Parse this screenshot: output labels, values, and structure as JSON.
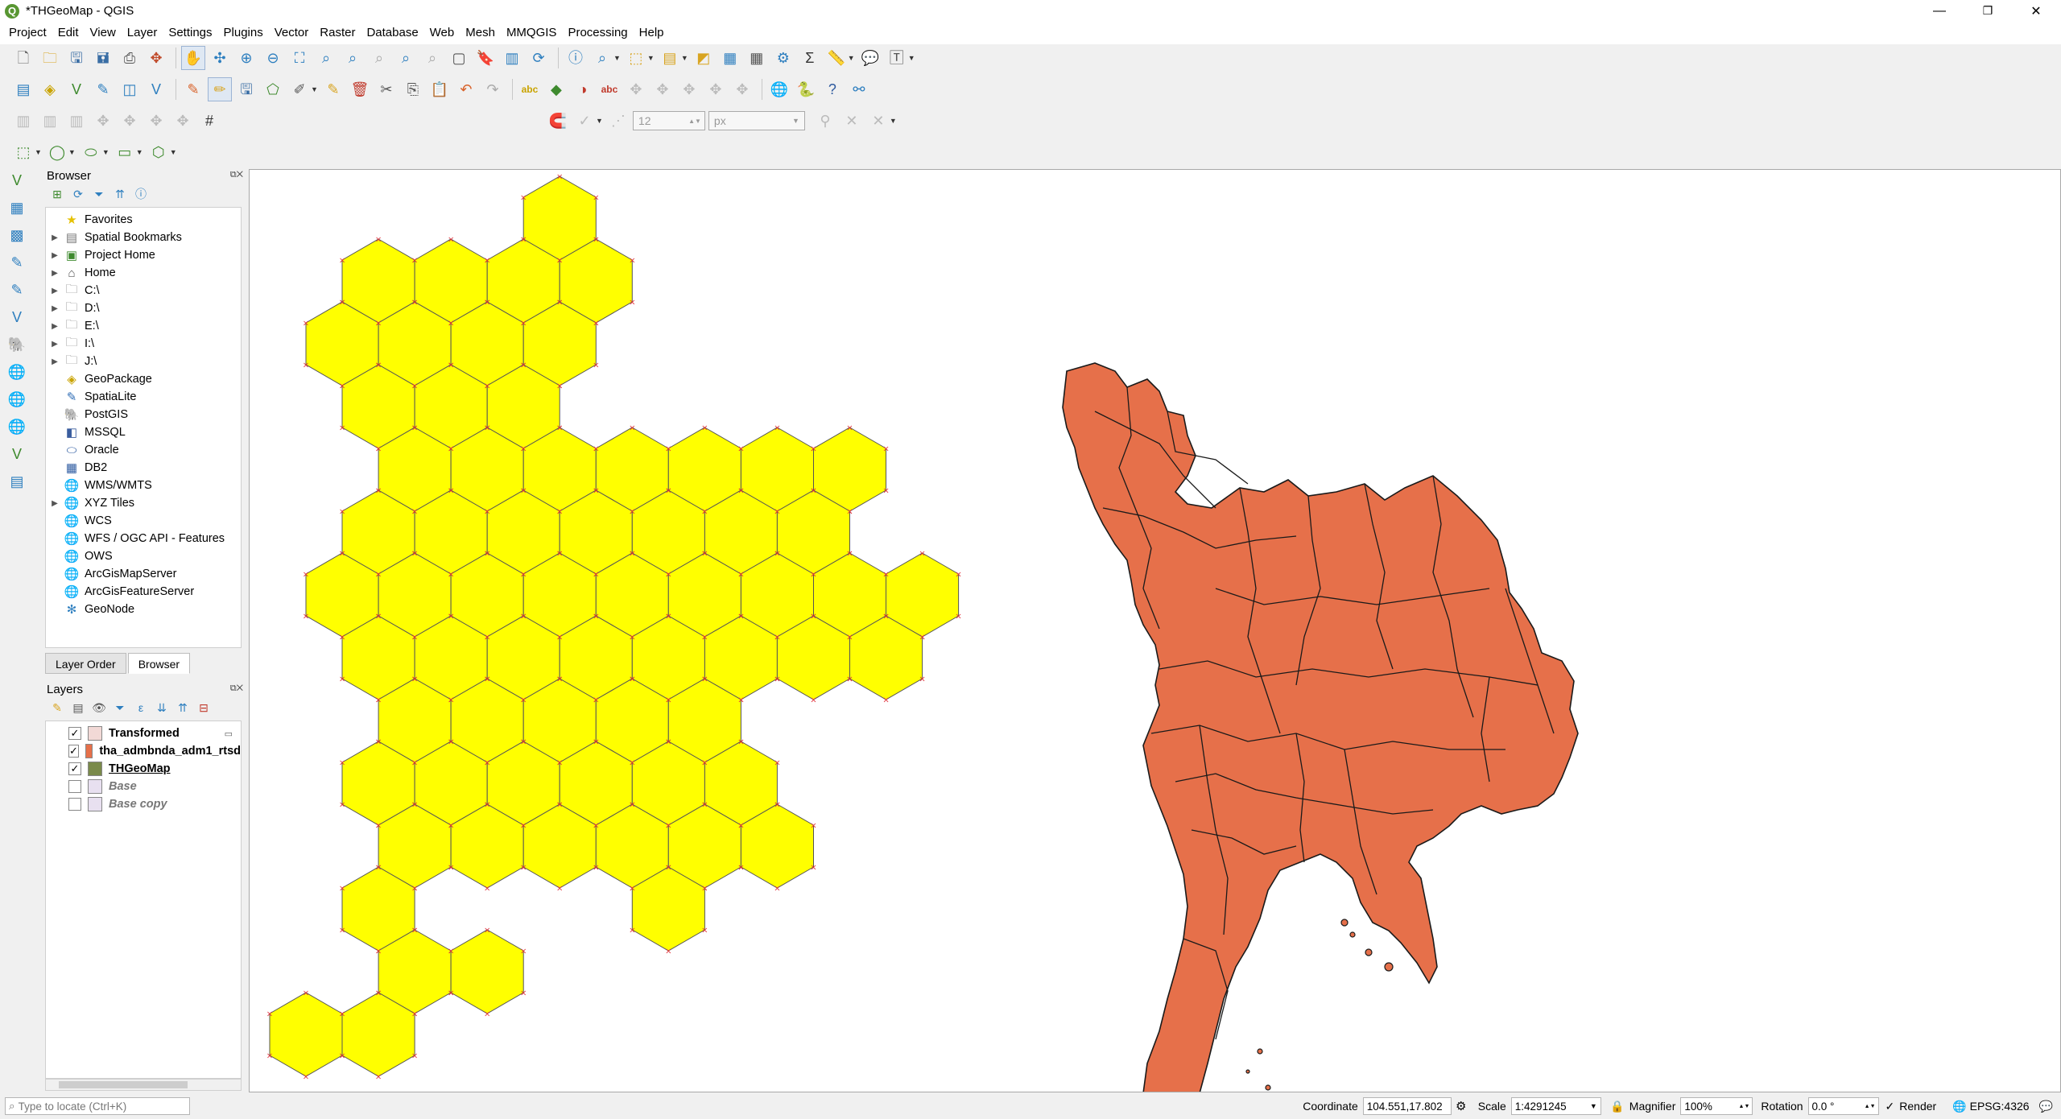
{
  "window": {
    "title": "*THGeoMap - QGIS",
    "app_icon_letter": "Q",
    "minimize": "—",
    "maximize": "❐",
    "close": "✕"
  },
  "menubar": [
    "Project",
    "Edit",
    "View",
    "Layer",
    "Settings",
    "Plugins",
    "Vector",
    "Raster",
    "Database",
    "Web",
    "Mesh",
    "MMQGIS",
    "Processing",
    "Help"
  ],
  "digitizing": {
    "size_value": "12",
    "unit": "px"
  },
  "browser": {
    "title": "Browser",
    "items": [
      {
        "label": "Favorites",
        "icon": "star-icon",
        "glyph": "★",
        "color": "#e5c100",
        "expandable": false
      },
      {
        "label": "Spatial Bookmarks",
        "icon": "bookmark-icon",
        "glyph": "▤",
        "color": "#777",
        "expandable": true
      },
      {
        "label": "Project Home",
        "icon": "project-home-icon",
        "glyph": "▣",
        "color": "#3e8a2e",
        "expandable": true
      },
      {
        "label": "Home",
        "icon": "home-icon",
        "glyph": "⌂",
        "color": "#555",
        "expandable": true
      },
      {
        "label": "C:\\",
        "icon": "folder-icon",
        "glyph": "🗀",
        "color": "#777",
        "expandable": true
      },
      {
        "label": "D:\\",
        "icon": "folder-icon",
        "glyph": "🗀",
        "color": "#777",
        "expandable": true
      },
      {
        "label": "E:\\",
        "icon": "folder-icon",
        "glyph": "🗀",
        "color": "#777",
        "expandable": true
      },
      {
        "label": "I:\\",
        "icon": "folder-icon",
        "glyph": "🗀",
        "color": "#777",
        "expandable": true
      },
      {
        "label": "J:\\",
        "icon": "folder-icon",
        "glyph": "🗀",
        "color": "#777",
        "expandable": true
      },
      {
        "label": "GeoPackage",
        "icon": "geopackage-icon",
        "glyph": "◈",
        "color": "#c9a300",
        "expandable": false
      },
      {
        "label": "SpatiaLite",
        "icon": "spatialite-icon",
        "glyph": "✎",
        "color": "#2f6db5",
        "expandable": false
      },
      {
        "label": "PostGIS",
        "icon": "postgis-icon",
        "glyph": "🐘",
        "color": "#336791",
        "expandable": false
      },
      {
        "label": "MSSQL",
        "icon": "mssql-icon",
        "glyph": "◧",
        "color": "#3a5d9e",
        "expandable": false
      },
      {
        "label": "Oracle",
        "icon": "oracle-icon",
        "glyph": "⬭",
        "color": "#2c5aa0",
        "expandable": false
      },
      {
        "label": "DB2",
        "icon": "db2-icon",
        "glyph": "▦",
        "color": "#2c5aa0",
        "expandable": false
      },
      {
        "label": "WMS/WMTS",
        "icon": "wms-globe-icon",
        "glyph": "🌐",
        "color": "#2e7fbf",
        "expandable": false
      },
      {
        "label": "XYZ Tiles",
        "icon": "xyz-tiles-icon",
        "glyph": "🌐",
        "color": "#2e7fbf",
        "expandable": true
      },
      {
        "label": "WCS",
        "icon": "wcs-globe-icon",
        "glyph": "🌐",
        "color": "#2e7fbf",
        "expandable": false
      },
      {
        "label": "WFS / OGC API - Features",
        "icon": "wfs-globe-icon",
        "glyph": "🌐",
        "color": "#2e7fbf",
        "expandable": false
      },
      {
        "label": "OWS",
        "icon": "ows-globe-icon",
        "glyph": "🌐",
        "color": "#8fa9c4",
        "expandable": false
      },
      {
        "label": "ArcGisMapServer",
        "icon": "arcgis-map-icon",
        "glyph": "🌐",
        "color": "#2e7fbf",
        "expandable": false
      },
      {
        "label": "ArcGisFeatureServer",
        "icon": "arcgis-feature-icon",
        "glyph": "🌐",
        "color": "#2e7fbf",
        "expandable": false
      },
      {
        "label": "GeoNode",
        "icon": "geonode-icon",
        "glyph": "✻",
        "color": "#2e7fbf",
        "expandable": false
      }
    ]
  },
  "tabs": {
    "layer_order": "Layer Order",
    "browser": "Browser"
  },
  "layers": {
    "title": "Layers",
    "items": [
      {
        "label": "Transformed",
        "checked": true,
        "swatch": "#f2d9d6",
        "style": "bold"
      },
      {
        "label": "tha_admbnda_adm1_rtsd",
        "checked": true,
        "swatch": "#e6704a",
        "style": "bold"
      },
      {
        "label": "THGeoMap",
        "checked": true,
        "swatch": "#7a8a4a",
        "style": "bold-underline"
      },
      {
        "label": "Base",
        "checked": false,
        "swatch": "#e8e0f0",
        "style": "bold-italic"
      },
      {
        "label": "Base copy",
        "checked": false,
        "swatch": "#e8e0f0",
        "style": "bold-italic"
      }
    ]
  },
  "map": {
    "hex_fill": "#ffff00",
    "hex_stroke": "#555555",
    "vertex_marker": "#e0303a",
    "thailand_fill": "#e6704a",
    "thailand_stroke": "#1a1a1a"
  },
  "status": {
    "locator_placeholder": "Type to locate (Ctrl+K)",
    "coordinate_label": "Coordinate",
    "coordinate": "104.551,17.802",
    "scale_label": "Scale",
    "scale": "1:4291245",
    "magnifier_label": "Magnifier",
    "magnifier": "100%",
    "rotation_label": "Rotation",
    "rotation": "0.0 °",
    "render_label": "Render",
    "crs": "EPSG:4326"
  }
}
